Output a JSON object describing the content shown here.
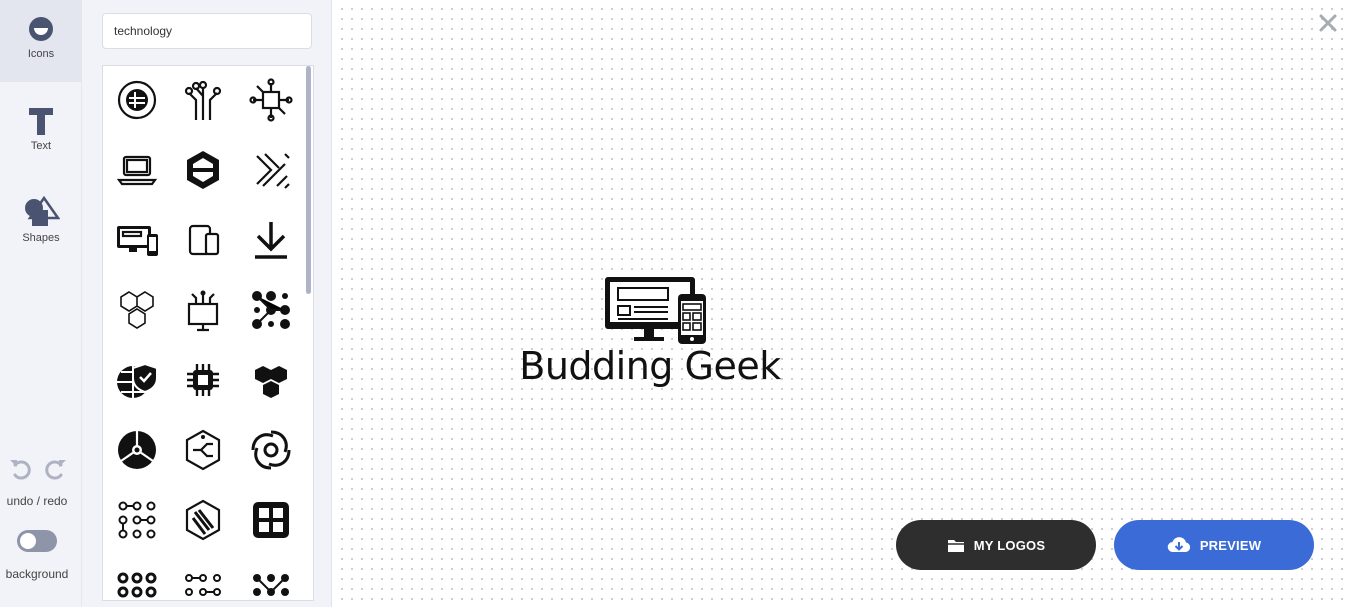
{
  "rail": {
    "tools": [
      {
        "label": "Icons",
        "icon": "icons-tool-icon",
        "active": true
      },
      {
        "label": "Text",
        "icon": "text-tool-icon"
      },
      {
        "label": "Shapes",
        "icon": "shapes-tool-icon"
      }
    ],
    "undo_redo_label": "undo / redo",
    "background_label": "background",
    "background_toggle_on": false
  },
  "panel": {
    "search_value": "technology",
    "icons": [
      "circuit-circle-icon",
      "circuit-tree-icon",
      "circuit-chip-icon",
      "laptop-icon",
      "hexagon-link-icon",
      "circuit-arrows-icon",
      "responsive-devices-icon",
      "tablet-phone-icon",
      "download-icon",
      "hexagon-cluster-icon",
      "network-tablet-icon",
      "dot-matrix-icon",
      "globe-shield-icon",
      "processor-chip-icon",
      "hexagon-trio-icon",
      "segmented-circle-icon",
      "hex-circuit-icon",
      "swirl-tech-icon",
      "dot-grid-icon",
      "hex-slash-icon",
      "quad-square-icon",
      "dot-matrix-2-icon",
      "dot-network-icon",
      "dot-matrix-3-icon"
    ]
  },
  "canvas": {
    "logo_text": "Budding Geek",
    "logo_icon": "responsive-devices-icon"
  },
  "actions": {
    "my_logos_label": "MY LOGOS",
    "preview_label": "PREVIEW"
  },
  "colors": {
    "accent": "#3b6bd6",
    "dark_button": "#2e2e2e",
    "rail_bg": "#f2f3f8",
    "tool_icon": "#4a5470"
  }
}
